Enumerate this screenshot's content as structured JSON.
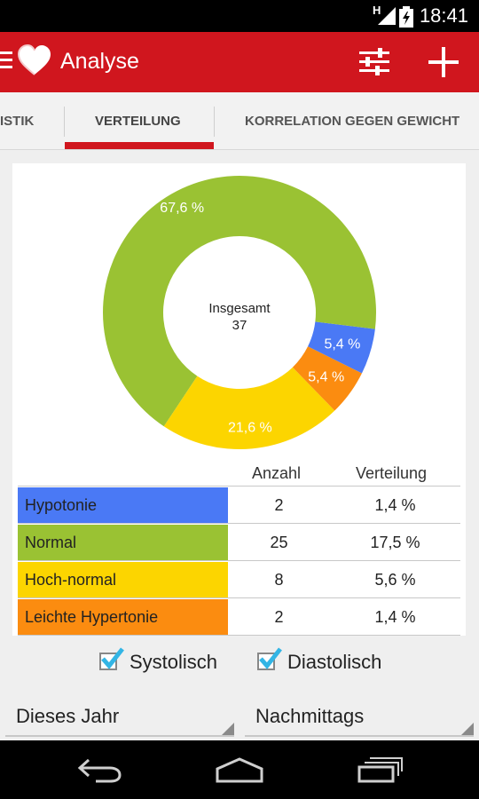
{
  "status_bar": {
    "time": "18:41",
    "network": "H"
  },
  "app_bar": {
    "title": "Analyse"
  },
  "tabs": [
    {
      "label": "ISTIK"
    },
    {
      "label": "VERTEILUNG",
      "selected": true
    },
    {
      "label": "KORRELATION GEGEN GEWICHT"
    }
  ],
  "chart": {
    "center_title": "Insgesamt",
    "center_value": "37",
    "chart_data": {
      "type": "pie",
      "categories": [
        "Hypotonie",
        "Normal",
        "Hoch-normal",
        "Leichte Hypertonie"
      ],
      "values": [
        5.4,
        67.6,
        21.6,
        5.4
      ],
      "labels": [
        "5,4 %",
        "67,6 %",
        "21,6 %",
        "5,4 %"
      ],
      "colors": [
        "#4a79f5",
        "#9ac233",
        "#fcd500",
        "#fb8c10"
      ]
    }
  },
  "table": {
    "headers": {
      "count": "Anzahl",
      "distribution": "Verteilung"
    },
    "rows": [
      {
        "category": "Hypotonie",
        "count": "2",
        "distribution": "1,4 %",
        "color": "#4a79f5"
      },
      {
        "category": "Normal",
        "count": "25",
        "distribution": "17,5 %",
        "color": "#9ac233"
      },
      {
        "category": "Hoch-normal",
        "count": "8",
        "distribution": "5,6 %",
        "color": "#fcd500"
      },
      {
        "category": "Leichte Hypertonie",
        "count": "2",
        "distribution": "1,4 %",
        "color": "#fb8c10"
      }
    ]
  },
  "checkboxes": [
    {
      "label": "Systolisch",
      "checked": true
    },
    {
      "label": "Diastolisch",
      "checked": true
    }
  ],
  "spinners": [
    {
      "value": "Dieses Jahr"
    },
    {
      "value": "Nachmittags"
    }
  ],
  "colors": {
    "primary": "#d0161e",
    "check": "#33b5e5"
  }
}
